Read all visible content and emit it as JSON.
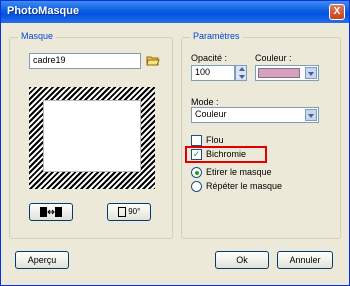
{
  "window": {
    "title": "PhotoMasque",
    "close_label": "X"
  },
  "masque": {
    "legend": "Masque",
    "name_value": "cadre19",
    "folder_icon": "folder-open-icon"
  },
  "preview_buttons": {
    "swap_icon": "swap-icon",
    "rotate_label": "90°"
  },
  "parametres": {
    "legend": "Paramètres",
    "opacite_label": "Opacité :",
    "opacite_value": "100",
    "couleur_label": "Couleur :",
    "couleur_swatch": "#d8a0c0",
    "mode_label": "Mode :",
    "mode_value": "Couleur",
    "flou_label": "Flou",
    "flou_checked": false,
    "bichromie_label": "Bichromie",
    "bichromie_checked": true,
    "radio_etirer": "Etirer le masque",
    "radio_repeter": "Répéter le masque",
    "radio_selected": "etirer"
  },
  "footer": {
    "apercu": "Aperçu",
    "ok": "Ok",
    "annuler": "Annuler"
  },
  "colors": {
    "title_gradient": "#0054e3",
    "highlight": "#e00000",
    "legend": "#0046d5"
  }
}
